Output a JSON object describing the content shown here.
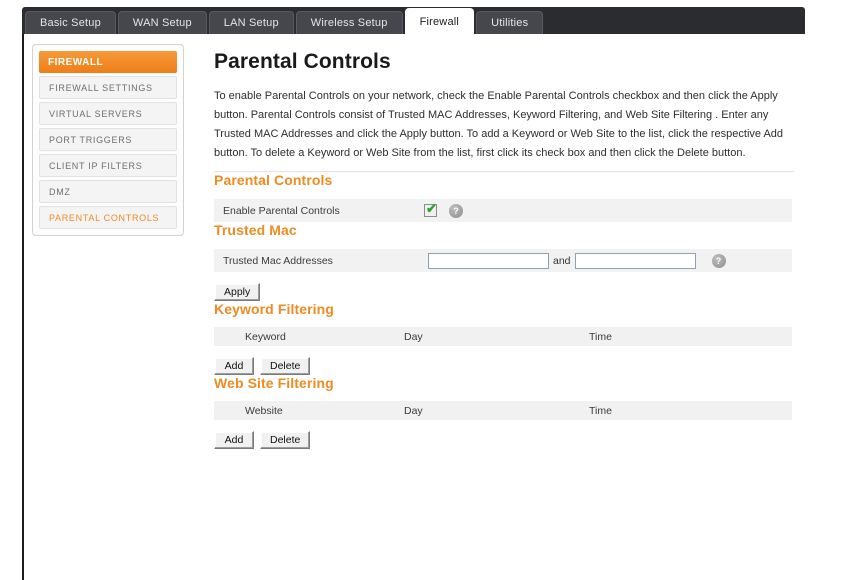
{
  "nav": {
    "tabs": [
      {
        "label": "Basic Setup",
        "active": false
      },
      {
        "label": "WAN Setup",
        "active": false
      },
      {
        "label": "LAN Setup",
        "active": false
      },
      {
        "label": "Wireless Setup",
        "active": false
      },
      {
        "label": "Firewall",
        "active": true
      },
      {
        "label": "Utilities",
        "active": false
      }
    ]
  },
  "sidebar": {
    "header": "FIREWALL",
    "items": [
      {
        "label": "FIREWALL SETTINGS",
        "selected": false
      },
      {
        "label": "VIRTUAL SERVERS",
        "selected": false
      },
      {
        "label": "PORT TRIGGERS",
        "selected": false
      },
      {
        "label": "CLIENT IP FILTERS",
        "selected": false
      },
      {
        "label": "DMZ",
        "selected": false
      },
      {
        "label": "PARENTAL CONTROLS",
        "selected": true
      }
    ]
  },
  "main": {
    "title": "Parental Controls",
    "intro": "To enable Parental Controls on your network, check the Enable Parental Controls checkbox and then click the Apply button. Parental Controls consist of Trusted MAC Addresses, Keyword Filtering, and Web Site Filtering . Enter any Trusted MAC Addresses and click the Apply button. To add a Keyword or Web Site to the list, click the respective Add button. To delete a Keyword or Web Site from the list, first click its check box and then click the Delete button.",
    "parental": {
      "title": "Parental Controls",
      "enable_label": "Enable Parental Controls",
      "enable_checked": true,
      "check_glyph": "✔",
      "help_glyph": "?"
    },
    "trusted": {
      "title": "Trusted Mac",
      "label": "Trusted Mac Addresses",
      "field1_value": "",
      "field1_placeholder": "",
      "and_label": "and",
      "field2_value": "",
      "field2_placeholder": "",
      "help_glyph": "?",
      "apply_label": "Apply"
    },
    "keyword": {
      "title": "Keyword Filtering",
      "columns": [
        "Keyword",
        "Day",
        "Time"
      ],
      "rows": [],
      "add_label": "Add",
      "delete_label": "Delete"
    },
    "website": {
      "title": "Web Site Filtering",
      "columns": [
        "Website",
        "Day",
        "Time"
      ],
      "rows": [],
      "add_label": "Add",
      "delete_label": "Delete"
    }
  },
  "colors": {
    "accent": "#ee8b22",
    "navbar": "#2b2c30",
    "tab_inactive": "#46474c",
    "row_bg": "#f2f2f2",
    "check_green": "#2fa32f"
  }
}
